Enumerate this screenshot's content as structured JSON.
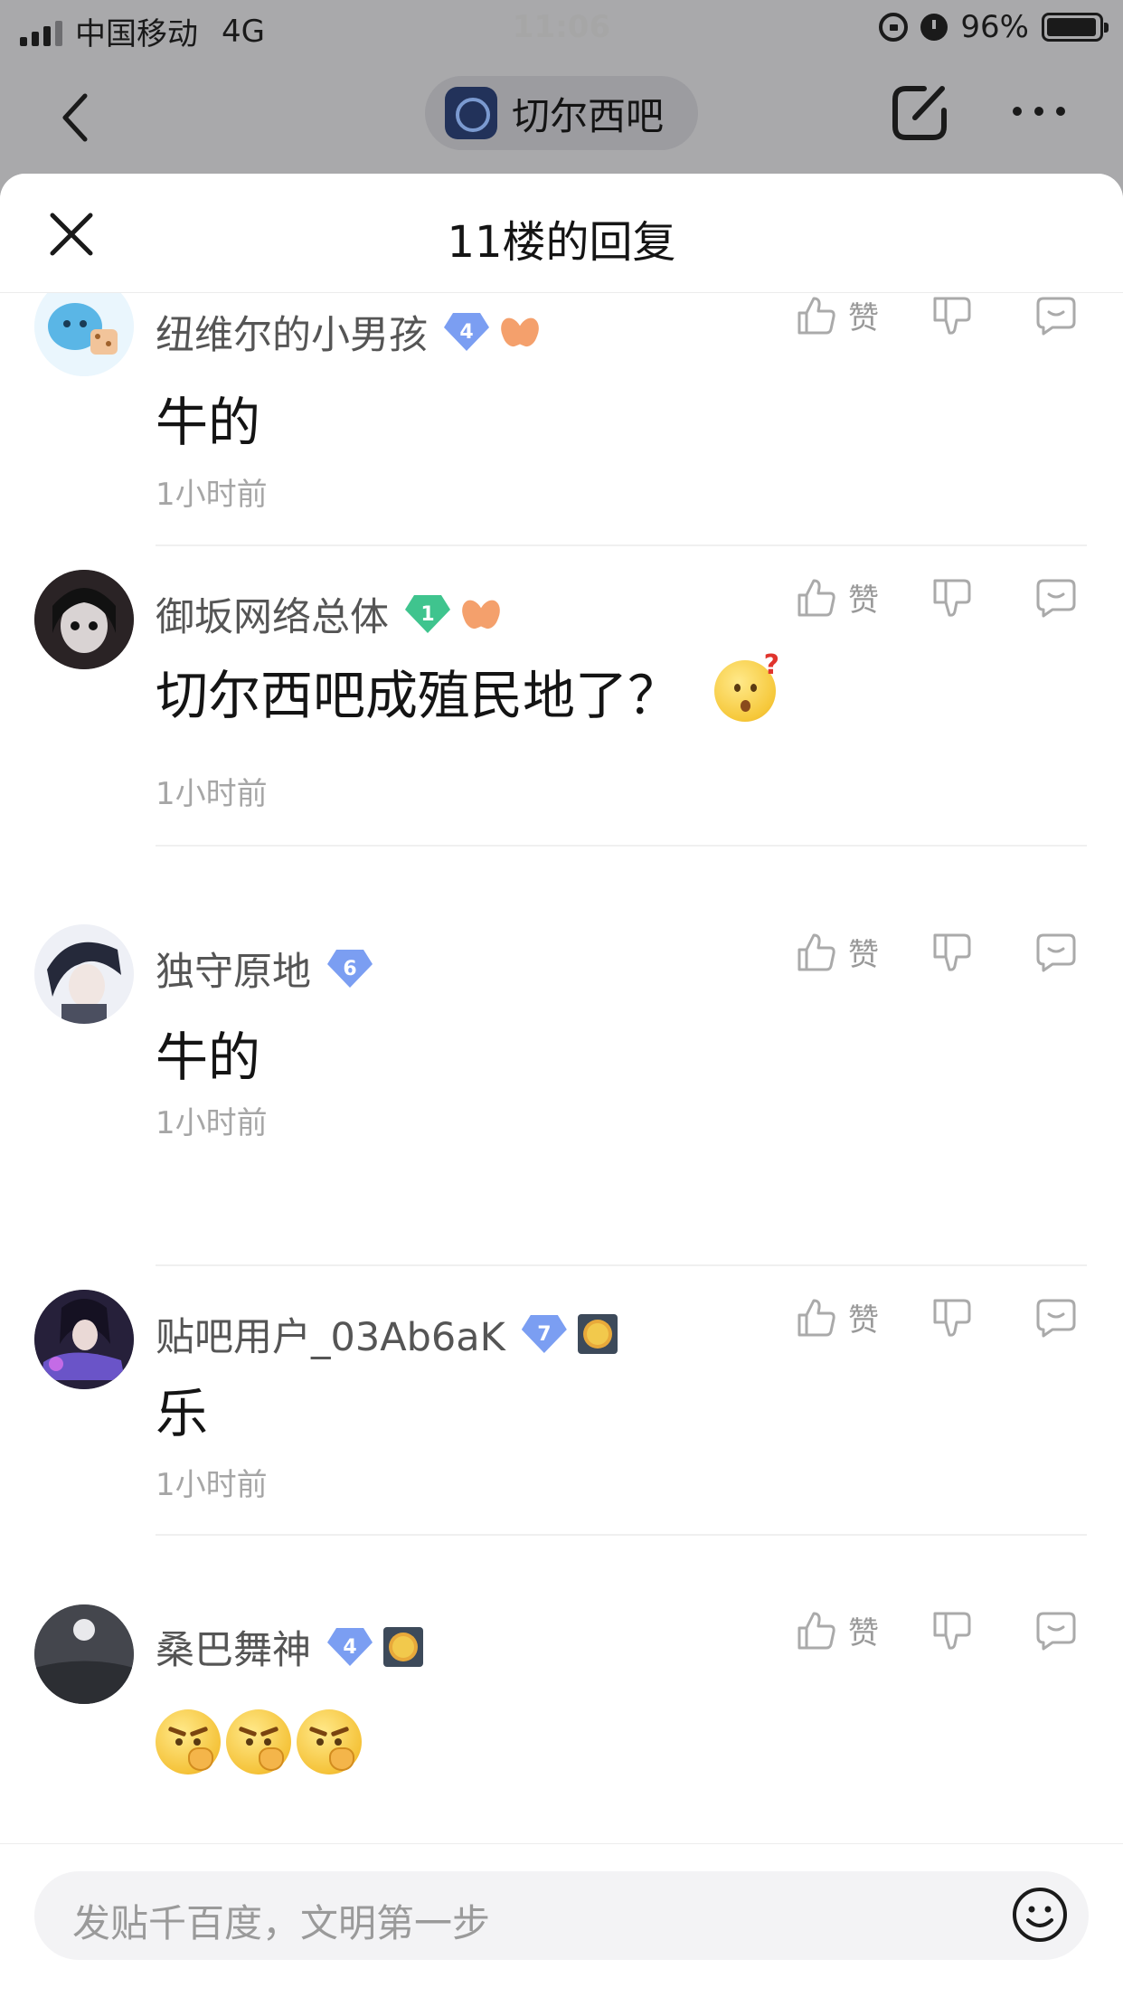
{
  "status_bar": {
    "carrier": "中国移动",
    "network": "4G",
    "time": "11:06",
    "battery": "96%",
    "battery_level": 0.96
  },
  "nav": {
    "forum_name": "切尔西吧"
  },
  "sheet": {
    "title": "11楼的回复"
  },
  "replies": [
    {
      "username": "纽维尔的小男孩",
      "level": "4",
      "level_color": "#7b9ef2",
      "badge": "flower-badge",
      "content": "牛的",
      "time": "1小时前",
      "like_label": "赞"
    },
    {
      "username": "御坂网络总体",
      "level": "1",
      "level_color": "#3fc48e",
      "badge": "flower-badge",
      "content": "切尔西吧成殖民地了？",
      "content_emoji": "confused-face-emoji",
      "time": "1小时前",
      "like_label": "赞"
    },
    {
      "username": "独守原地",
      "level": "6",
      "level_color": "#7b9ef2",
      "content": "牛的",
      "time": "1小时前",
      "like_label": "赞"
    },
    {
      "username": "贴吧用户_03Ab6aK",
      "level": "7",
      "level_color": "#7b9ef2",
      "badge": "sun-badge",
      "content": "乐",
      "time": "1小时前",
      "like_label": "赞"
    },
    {
      "username": "桑巴舞神",
      "level": "4",
      "level_color": "#7b9ef2",
      "badge": "sun-badge",
      "content_emojis": [
        "angry-face-emoji",
        "angry-face-emoji",
        "angry-face-emoji"
      ],
      "like_label": "赞"
    }
  ],
  "bottom": {
    "placeholder": "发贴千百度，文明第一步"
  }
}
